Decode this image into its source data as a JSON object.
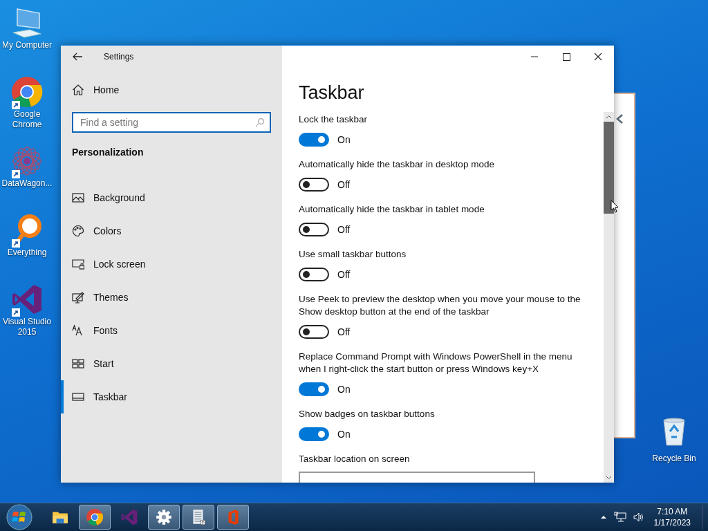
{
  "desktop_icons": [
    {
      "kind": "computer",
      "label": "My Computer",
      "shortcut": false
    },
    {
      "kind": "chrome",
      "label": "Google Chrome",
      "shortcut": true
    },
    {
      "kind": "datawagon",
      "label": "DataWagon...",
      "shortcut": true
    },
    {
      "kind": "everything",
      "label": "Everything",
      "shortcut": true
    },
    {
      "kind": "vs",
      "label": "Visual Studio 2015",
      "shortcut": true
    }
  ],
  "recycle_bin": {
    "label": "Recycle Bin"
  },
  "window": {
    "title": "Settings",
    "sidebar": {
      "home": "Home",
      "search": {
        "placeholder": "Find a setting"
      },
      "section": "Personalization",
      "items": [
        {
          "kind": "background",
          "label": "Background",
          "selected": false
        },
        {
          "kind": "colors",
          "label": "Colors",
          "selected": false
        },
        {
          "kind": "lock",
          "label": "Lock screen",
          "selected": false
        },
        {
          "kind": "themes",
          "label": "Themes",
          "selected": false
        },
        {
          "kind": "fonts",
          "label": "Fonts",
          "selected": false
        },
        {
          "kind": "start",
          "label": "Start",
          "selected": false
        },
        {
          "kind": "taskbar",
          "label": "Taskbar",
          "selected": true
        }
      ]
    },
    "content": {
      "heading": "Taskbar",
      "settings": [
        {
          "kind": "toggle",
          "label": "Lock the taskbar",
          "on": true,
          "state": "On"
        },
        {
          "kind": "toggle",
          "label": "Automatically hide the taskbar in desktop mode",
          "on": false,
          "state": "Off"
        },
        {
          "kind": "toggle",
          "label": "Automatically hide the taskbar in tablet mode",
          "on": false,
          "state": "Off"
        },
        {
          "kind": "toggle",
          "label": "Use small taskbar buttons",
          "on": false,
          "state": "Off"
        },
        {
          "kind": "toggle",
          "label": "Use Peek to preview the desktop when you move your mouse to the Show desktop button at the end of the taskbar",
          "on": false,
          "state": "Off"
        },
        {
          "kind": "toggle",
          "label": "Replace Command Prompt with Windows PowerShell in the menu when I right-click the start button or press Windows key+X",
          "on": true,
          "state": "On"
        },
        {
          "kind": "toggle",
          "label": "Show badges on taskbar buttons",
          "on": true,
          "state": "On"
        },
        {
          "kind": "dropdown",
          "label": "Taskbar location on screen"
        }
      ]
    }
  },
  "taskbar": {
    "apps": [
      {
        "kind": "explorer",
        "running": false
      },
      {
        "kind": "chrome",
        "running": true
      },
      {
        "kind": "vs",
        "running": false
      },
      {
        "kind": "settings",
        "running": true
      },
      {
        "kind": "document",
        "running": true
      },
      {
        "kind": "office",
        "running": true
      }
    ],
    "clock": {
      "time": "7:10 AM",
      "date": "1/17/2023"
    }
  }
}
